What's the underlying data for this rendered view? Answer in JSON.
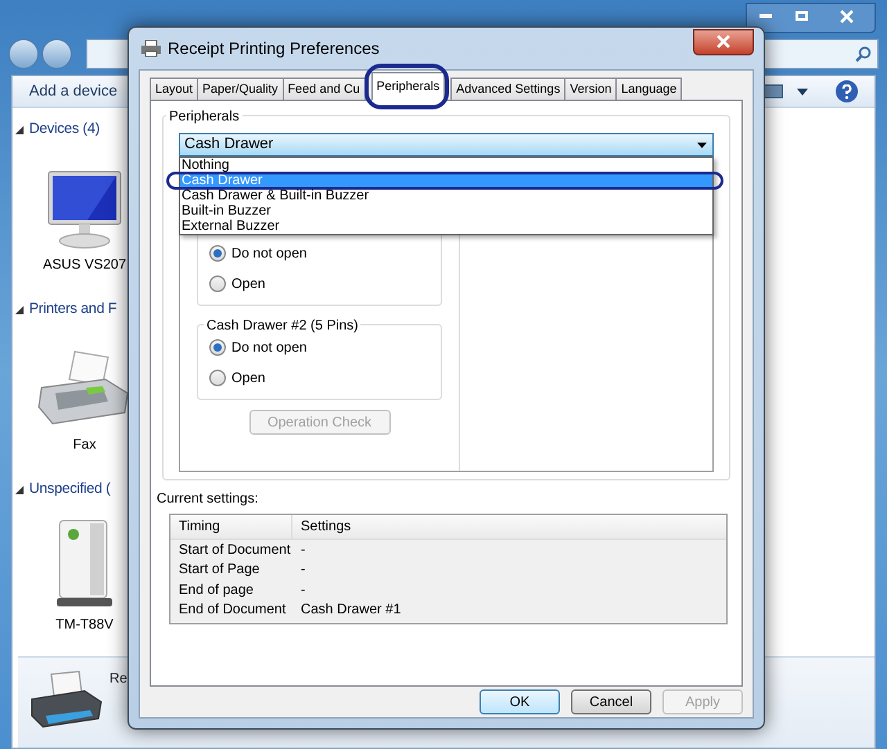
{
  "explorer": {
    "command_bar": {
      "add_button": "Add a device"
    },
    "sections": [
      {
        "title": "Devices (4)",
        "expanded": true,
        "items": [
          {
            "label": "ASUS VS207",
            "kind": "monitor"
          }
        ]
      },
      {
        "title": "Printers and F",
        "expanded": true,
        "items": [
          {
            "label": "Fax",
            "kind": "fax"
          }
        ]
      },
      {
        "title": "Unspecified (",
        "expanded": true,
        "items": [
          {
            "label": "TM-T88V",
            "kind": "tower"
          }
        ]
      }
    ],
    "details_pane": {
      "label": "Re"
    }
  },
  "dialog": {
    "title": "Receipt Printing Preferences",
    "tabs": [
      {
        "label": "Layout",
        "selected": false,
        "highlighted": false
      },
      {
        "label": "Paper/Quality",
        "selected": false,
        "highlighted": false
      },
      {
        "label": "Feed and Cu",
        "selected": false,
        "highlighted": false
      },
      {
        "label": "Peripherals",
        "selected": true,
        "highlighted": true
      },
      {
        "label": "Advanced Settings",
        "selected": false,
        "highlighted": false
      },
      {
        "label": "Version",
        "selected": false,
        "highlighted": false
      },
      {
        "label": "Language",
        "selected": false,
        "highlighted": false
      }
    ],
    "peripherals": {
      "title": "Peripherals",
      "value": "Cash Drawer",
      "expanded": true,
      "options": [
        {
          "label": "Nothing",
          "selected": false,
          "highlighted": false
        },
        {
          "label": "Cash Drawer",
          "selected": true,
          "highlighted": true
        },
        {
          "label": "Cash Drawer & Built-in Buzzer",
          "selected": false,
          "highlighted": false
        },
        {
          "label": "Built-in Buzzer",
          "selected": false,
          "highlighted": false
        },
        {
          "label": "External Buzzer",
          "selected": false,
          "highlighted": false
        }
      ]
    },
    "drawer_groups": [
      {
        "radios": [
          {
            "label": "Do not open",
            "selected": true
          },
          {
            "label": "Open",
            "selected": false
          }
        ]
      },
      {
        "title": "Cash Drawer #2 (5 Pins)",
        "radios": [
          {
            "label": "Do not open",
            "selected": true
          },
          {
            "label": "Open",
            "selected": false
          }
        ]
      }
    ],
    "operation_check": {
      "label": "Operation Check",
      "disabled": true
    },
    "current_settings": {
      "title": "Current settings:",
      "columns": [
        "Timing",
        "Settings"
      ],
      "rows": [
        [
          "Start of Document",
          "-"
        ],
        [
          "Start of Page",
          "-"
        ],
        [
          "End of page",
          "-"
        ],
        [
          "End of Document",
          "Cash Drawer #1"
        ]
      ]
    },
    "buttons": [
      {
        "label": "OK",
        "disabled": false
      },
      {
        "label": "Cancel",
        "disabled": false
      },
      {
        "label": "Apply",
        "disabled": true
      }
    ]
  }
}
